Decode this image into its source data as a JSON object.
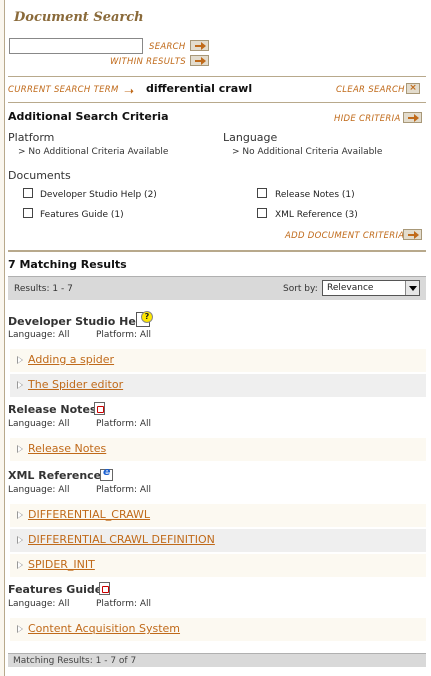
{
  "title": "Document Search",
  "search": {
    "value": "",
    "search_label": "SEARCH",
    "within_label": "WITHIN RESULTS"
  },
  "current": {
    "label": "CURRENT SEARCH TERM",
    "term": "differential crawl",
    "clear_label": "CLEAR SEARCH"
  },
  "criteria": {
    "title": "Additional Search Criteria",
    "hide_label": "HIDE CRITERIA",
    "platform_label": "Platform",
    "platform_value": "> No Additional Criteria Available",
    "language_label": "Language",
    "language_value": "> No Additional Criteria Available",
    "documents_label": "Documents",
    "documents": [
      {
        "label": "Developer Studio Help (2)",
        "checked": false
      },
      {
        "label": "Release Notes (1)",
        "checked": false
      },
      {
        "label": "Features Guide (1)",
        "checked": false
      },
      {
        "label": "XML Reference (3)",
        "checked": false
      }
    ],
    "add_label": "ADD DOCUMENT CRITERIA"
  },
  "results": {
    "title": "7 Matching Results",
    "range": "Results: 1 - 7",
    "sort_label": "Sort by:",
    "sort_value": "Relevance",
    "groups": [
      {
        "title": "Developer Studio Help",
        "icon": "help-icon",
        "language": "Language: All",
        "platform": "Platform: All",
        "items": [
          "Adding a spider",
          "The Spider editor"
        ]
      },
      {
        "title": "Release Notes",
        "icon": "pdf-icon",
        "language": "Language: All",
        "platform": "Platform: All",
        "items": [
          "Release Notes"
        ]
      },
      {
        "title": "XML Reference",
        "icon": "browser-icon",
        "language": "Language: All",
        "platform": "Platform: All",
        "items": [
          "DIFFERENTIAL_CRAWL",
          "DIFFERENTIAL CRAWL DEFINITION",
          "SPIDER_INIT"
        ]
      },
      {
        "title": "Features Guide",
        "icon": "pdf-icon",
        "language": "Language: All",
        "platform": "Platform: All",
        "items": [
          "Content Acquisition System"
        ]
      }
    ],
    "footer": "Matching Results: 1 - 7 of 7"
  },
  "colors": {
    "accent": "#c06a1a",
    "title": "#8a6a3a",
    "bar": "#d9d9d9",
    "row_light": "#fcf9f1",
    "row_gray": "#efefef"
  }
}
